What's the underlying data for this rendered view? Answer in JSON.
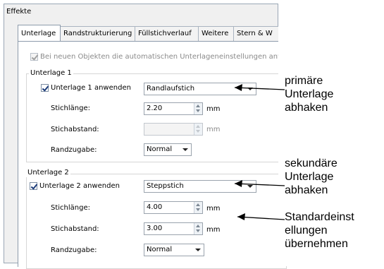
{
  "dialog": {
    "title": "Effekte"
  },
  "tabs": [
    {
      "label": "Unterlage",
      "active": true
    },
    {
      "label": "Randstrukturierung"
    },
    {
      "label": "Füllstichverlauf"
    },
    {
      "label": "Weitere"
    },
    {
      "label": "Stern & W"
    }
  ],
  "auto_checkbox": {
    "label": "Bei neuen Objekten die automatischen Unterlageneinstellungen anwende",
    "checked": true,
    "disabled": true
  },
  "underlay1": {
    "group_label": "Unterlage 1",
    "apply_label": "Unterlage 1 anwenden",
    "apply_checked": true,
    "type_value": "Randlaufstich",
    "stitch_length_label": "Stichlänge:",
    "stitch_length_value": "2.20",
    "stitch_length_unit": "mm",
    "stitch_spacing_label": "Stichabstand:",
    "stitch_spacing_value": "",
    "stitch_spacing_unit": "mm",
    "edge_label": "Randzugabe:",
    "edge_value": "Normal"
  },
  "underlay2": {
    "group_label": "Unterlage 2",
    "apply_label": "Unterlage 2 anwenden",
    "apply_checked": true,
    "type_value": "Steppstich",
    "stitch_length_label": "Stichlänge:",
    "stitch_length_value": "4.00",
    "stitch_length_unit": "mm",
    "stitch_spacing_label": "Stichabstand:",
    "stitch_spacing_value": "3.00",
    "stitch_spacing_unit": "mm",
    "edge_label": "Randzugabe:",
    "edge_value": "Normal"
  },
  "callouts": {
    "primary": [
      "primäre",
      "Unterlage",
      "abhaken"
    ],
    "secondary": [
      "sekundäre",
      "Unterlage",
      "abhaken"
    ],
    "defaults": [
      "Standardeinst",
      "ellungen",
      "übernehmen"
    ]
  }
}
